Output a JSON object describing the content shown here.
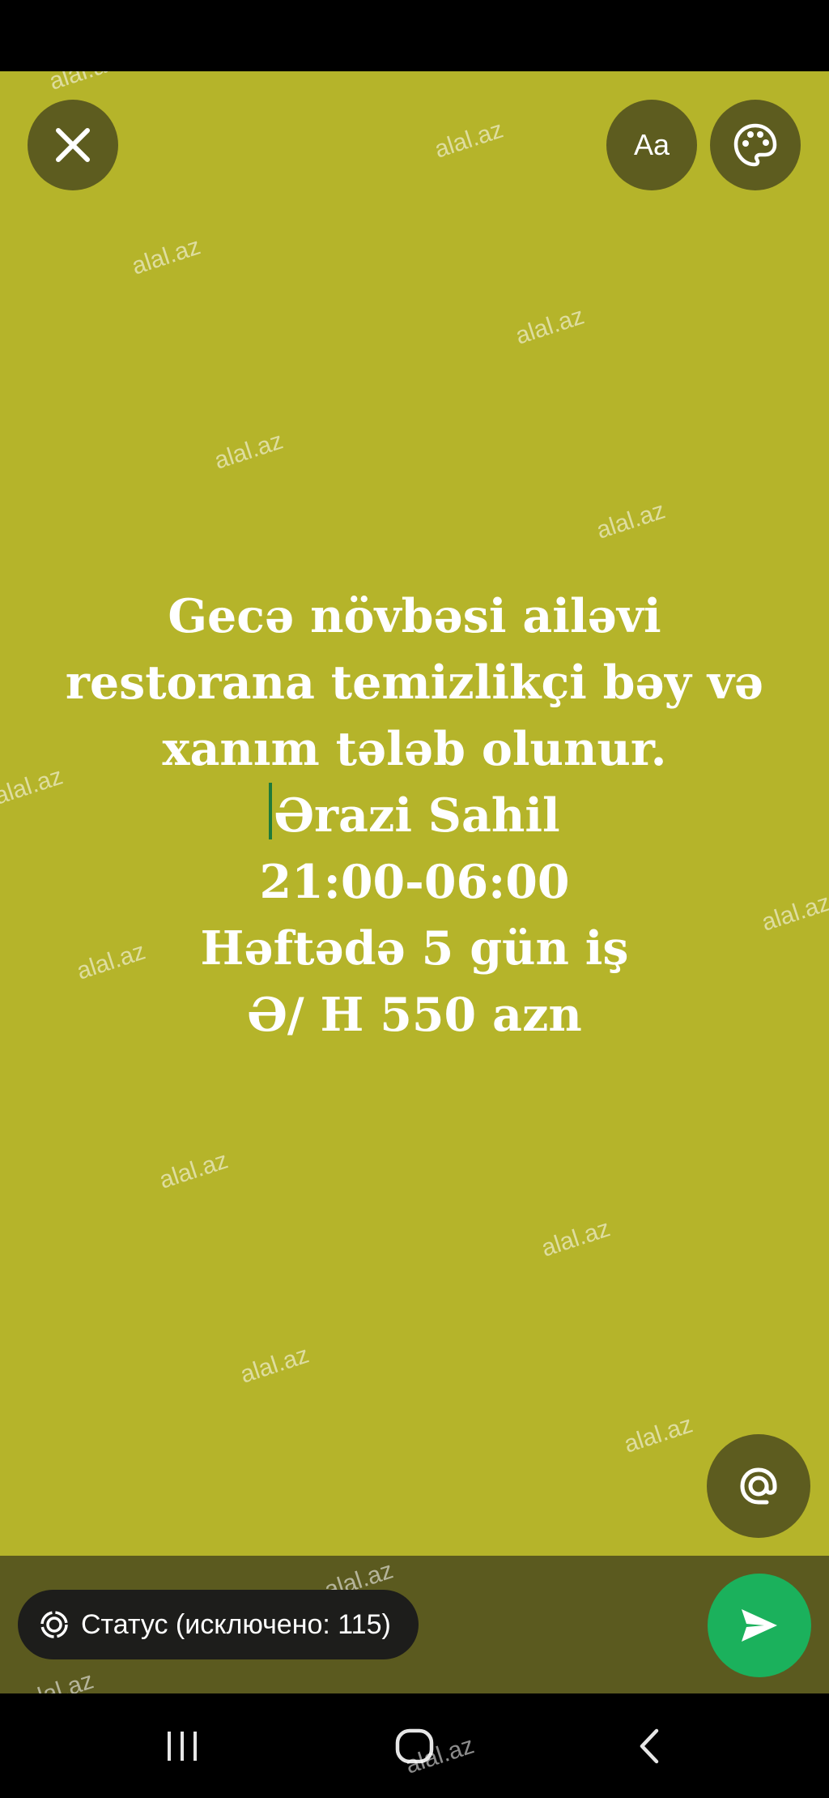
{
  "watermark_text": "alal.az",
  "toolbar": {
    "font_label": "Aa"
  },
  "status_lines": [
    "Gecə növbəsi ailəvi",
    "restorana temizlikçi bəy və",
    "xanım tələb olunur.",
    "Ərazi Sahil",
    "21:00-06:00",
    "Həftədə 5 gün iş",
    "Ə/ H 550 azn"
  ],
  "audience": {
    "label": "Статус (исключено: 115)"
  },
  "icons": {
    "close": "close-icon",
    "palette": "palette-icon",
    "mention": "at-sign-icon",
    "audience": "status-ring-icon",
    "send": "send-icon",
    "nav_recent": "recent-apps-icon",
    "nav_home": "home-icon",
    "nav_back": "back-icon"
  },
  "colors": {
    "background": "#b5b42a",
    "button": "#5d5c1f",
    "bottom_bar": "#5b5a1f",
    "send": "#1bb15c",
    "caret": "#1f7a3a"
  }
}
